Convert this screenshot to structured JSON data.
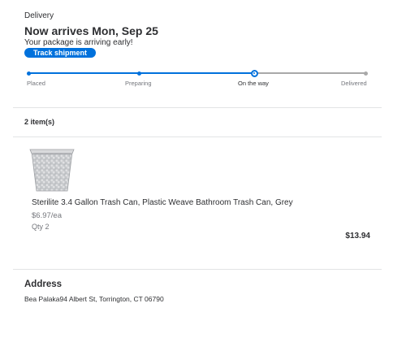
{
  "delivery": {
    "eyebrow": "Delivery",
    "headline": "Now arrives Mon, Sep 25",
    "subtext": "Your package is arriving early!",
    "track_button": "Track shipment"
  },
  "tracker": {
    "steps": [
      {
        "label": "Placed",
        "state": "complete"
      },
      {
        "label": "Preparing",
        "state": "complete"
      },
      {
        "label": "On the way",
        "state": "current"
      },
      {
        "label": "Delivered",
        "state": "pending"
      }
    ],
    "progress_color": "#0071dc",
    "pending_color": "#a9a9a9"
  },
  "items": {
    "count_label": "2 item(s)",
    "list": [
      {
        "image_icon": "wicker-wastebasket-image",
        "name": "Sterilite 3.4 Gallon Trash Can, Plastic Weave Bathroom Trash Can, Grey",
        "unit_price": "$6.97/ea",
        "quantity": "Qty 2",
        "total": "$13.94"
      }
    ]
  },
  "address": {
    "title": "Address",
    "text": "Bea Palaka94 Albert St, Torrington, CT 06790"
  },
  "colors": {
    "accent": "#0071dc",
    "text_primary": "#2e2f32",
    "text_secondary": "#74767c",
    "divider": "#e3e4e5"
  }
}
